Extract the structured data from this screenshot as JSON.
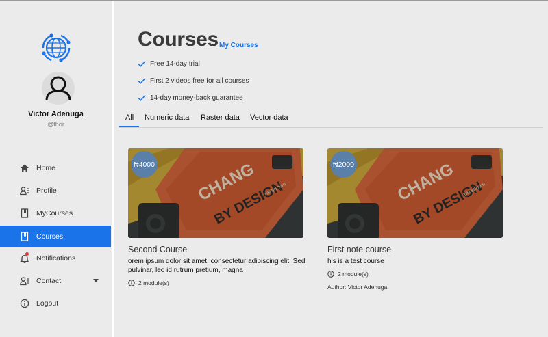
{
  "user": {
    "name": "Victor Adenuga",
    "handle": "@thor"
  },
  "sidebar": {
    "items": [
      {
        "label": "Home",
        "icon": "home-icon"
      },
      {
        "label": "Profile",
        "icon": "profile-icon"
      },
      {
        "label": "MyCourses",
        "icon": "book-icon"
      },
      {
        "label": "Courses",
        "icon": "book-icon",
        "active": true
      },
      {
        "label": "Notifications",
        "icon": "bell-icon"
      },
      {
        "label": "Contact",
        "icon": "contact-icon"
      },
      {
        "label": "Logout",
        "icon": "info-icon"
      }
    ]
  },
  "header": {
    "title": "Courses",
    "subtitle": "My Courses",
    "features": [
      "Free 14-day trial",
      "First 2 videos free for all courses",
      "14-day money-back guarantee"
    ]
  },
  "tabs": [
    {
      "label": "All",
      "active": true
    },
    {
      "label": "Numeric data"
    },
    {
      "label": "Raster data"
    },
    {
      "label": "Vector data"
    }
  ],
  "courses": [
    {
      "price": "₦4000",
      "title": "Second Course",
      "description": "orem ipsum dolor sit amet, consectetur adipiscing elit. Sed pulvinar, leo id rutrum pretium, magna",
      "modules": "2 module(s)",
      "author": ""
    },
    {
      "price": "₦2000",
      "title": "First note course",
      "description": "his is a test course",
      "modules": "2 module(s)",
      "author": "Author: Victor Adenuga"
    }
  ],
  "colors": {
    "accent": "#1a73e8",
    "price_badge": "#5a7fa8",
    "notification_dot": "#e53935"
  }
}
